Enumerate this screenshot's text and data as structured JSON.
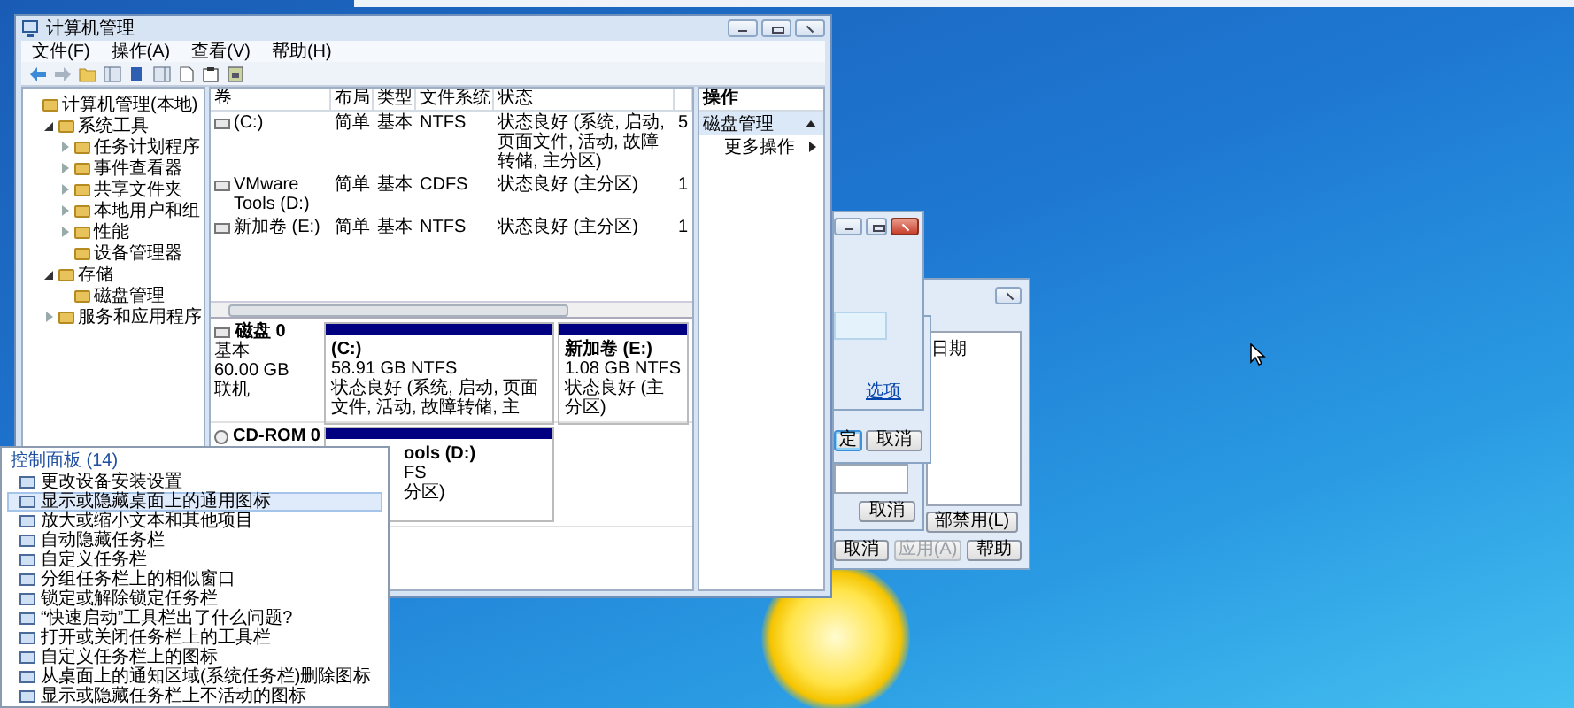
{
  "computer_management": {
    "title": "计算机管理",
    "menu": [
      "文件(F)",
      "操作(A)",
      "查看(V)",
      "帮助(H)"
    ],
    "tree": [
      {
        "label": "计算机管理(本地)",
        "children": [
          {
            "label": "系统工具",
            "expanded": true,
            "children": [
              {
                "label": "任务计划程序",
                "expanded": false
              },
              {
                "label": "事件查看器",
                "expanded": false
              },
              {
                "label": "共享文件夹",
                "expanded": false
              },
              {
                "label": "本地用户和组",
                "expanded": false
              },
              {
                "label": "性能",
                "expanded": false
              },
              {
                "label": "设备管理器"
              }
            ]
          },
          {
            "label": "存储",
            "expanded": true,
            "children": [
              {
                "label": "磁盘管理"
              }
            ]
          },
          {
            "label": "服务和应用程序",
            "expanded": false
          }
        ]
      }
    ],
    "volumes": {
      "columns": [
        "卷",
        "布局",
        "类型",
        "文件系统",
        "状态"
      ],
      "rows": [
        [
          "(C:)",
          "简单",
          "基本",
          "NTFS",
          "状态良好 (系统, 启动, 页面文件, 活动, 故障转储, 主分区)",
          "5"
        ],
        [
          "VMware Tools (D:)",
          "简单",
          "基本",
          "CDFS",
          "状态良好 (主分区)",
          "1"
        ],
        [
          "新加卷 (E:)",
          "简单",
          "基本",
          "NTFS",
          "状态良好 (主分区)",
          "1"
        ]
      ]
    },
    "disks": [
      {
        "kind": "disk",
        "name": "磁盘 0",
        "details": [
          "基本",
          "60.00 GB",
          "联机"
        ],
        "partitions": [
          {
            "name": "(C:)",
            "size": "58.91 GB NTFS",
            "status": "状态良好 (系统, 启动, 页面文件, 活动, 故障转储, 主"
          },
          {
            "name": "新加卷 (E:)",
            "size": "1.08 GB NTFS",
            "status": "状态良好 (主分区)"
          }
        ]
      },
      {
        "kind": "cdrom",
        "name": "CD-ROM 0",
        "partitions": [
          {
            "name": "ools (D:)",
            "size": "FS",
            "status": "分区)"
          }
        ]
      }
    ],
    "actions": {
      "title": "操作",
      "section": "磁盘管理",
      "items": [
        "更多操作"
      ]
    }
  },
  "control_panel_results": {
    "title": "控制面板 (14)",
    "items": [
      {
        "label": "更改设备安装设置",
        "selected": false
      },
      {
        "label": "显示或隐藏桌面上的通用图标",
        "selected": true
      },
      {
        "label": "放大或缩小文本和其他项目",
        "selected": false
      },
      {
        "label": "自动隐藏任务栏",
        "selected": false
      },
      {
        "label": "自定义任务栏",
        "selected": false
      },
      {
        "label": "分组任务栏上的相似窗口",
        "selected": false
      },
      {
        "label": "锁定或解除锁定任务栏",
        "selected": false
      },
      {
        "label": "“快速启动”工具栏出了什么问题?",
        "selected": false
      },
      {
        "label": "打开或关闭任务栏上的工具栏",
        "selected": false
      },
      {
        "label": "自定义任务栏上的图标",
        "selected": false
      },
      {
        "label": "从桌面上的通知区域(系统任务栏)删除图标",
        "selected": false
      },
      {
        "label": "显示或隐藏任务栏上不活动的图标",
        "selected": false
      }
    ]
  },
  "dialog_back": {
    "column": "日期",
    "side_button": "部禁用(L)",
    "buttons": [
      {
        "label": "取消",
        "disabled": false
      },
      {
        "label": "应用(A)",
        "disabled": true
      },
      {
        "label": "帮助",
        "disabled": false
      }
    ]
  },
  "dialog_middle": {
    "button": "取消"
  },
  "dialog_confirm": {
    "buttons": [
      {
        "label": "定",
        "default": true
      },
      {
        "label": "取消",
        "default": false
      }
    ]
  },
  "dialog_front": {
    "link": "选项"
  }
}
